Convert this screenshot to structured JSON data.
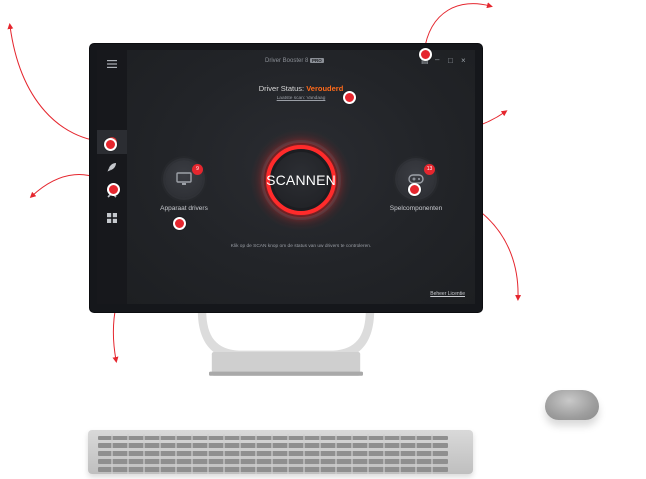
{
  "app": {
    "title": "Driver Booster 8",
    "edition_badge": "PRO"
  },
  "status": {
    "label": "Driver Status:",
    "value": "Verouderd",
    "value_color": "#ff6a1a",
    "last_scan": "Laatste scan: Vandaag"
  },
  "scan_button": {
    "label": "SCANNEN",
    "ring_color": "#ff2b2b"
  },
  "left_panel": {
    "label": "Apparaat drivers",
    "badge": "9",
    "icon": "monitor-icon"
  },
  "right_panel": {
    "label": "Spelcomponenten",
    "badge": "13",
    "icon": "gamepad-icon"
  },
  "hint": "Klik op de SCAN knop om de status van uw drivers te controleren.",
  "footer": {
    "license_link": "Beheer Licentie"
  },
  "sidebar": {
    "items": [
      {
        "icon": "hamburger-menu-icon"
      },
      {
        "icon": "scan-target-icon"
      },
      {
        "icon": "rocket-icon"
      },
      {
        "icon": "tools-icon"
      },
      {
        "icon": "grid-icon"
      }
    ]
  },
  "window_controls": {
    "icons": [
      "feedback-icon",
      "minimize-icon",
      "maximize-icon",
      "close-icon"
    ]
  },
  "accent_color": "#e5262e"
}
